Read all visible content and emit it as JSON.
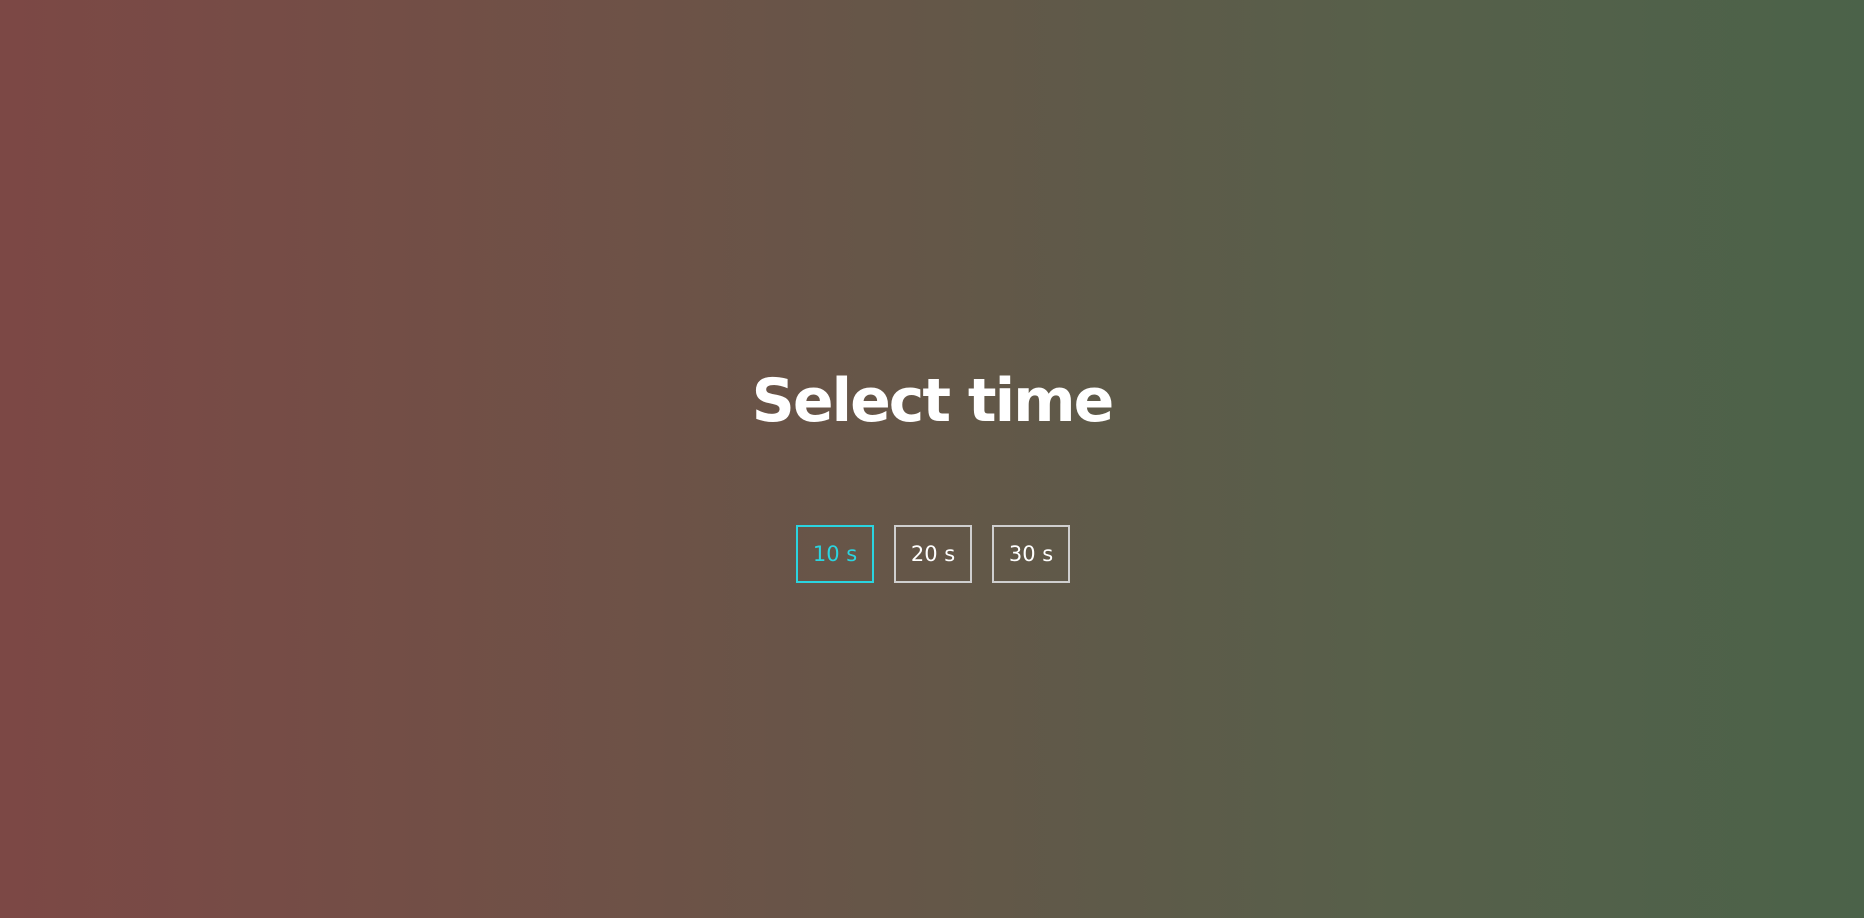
{
  "title": "Select time",
  "options": [
    {
      "label": "10 s",
      "selected": true
    },
    {
      "label": "20 s",
      "selected": false
    },
    {
      "label": "30 s",
      "selected": false
    }
  ],
  "colors": {
    "selected_accent": "#2ad4e0",
    "border": "#cfcfcf",
    "text": "#ffffff",
    "gradient_left": "#7c4845",
    "gradient_right": "#4b6249"
  }
}
